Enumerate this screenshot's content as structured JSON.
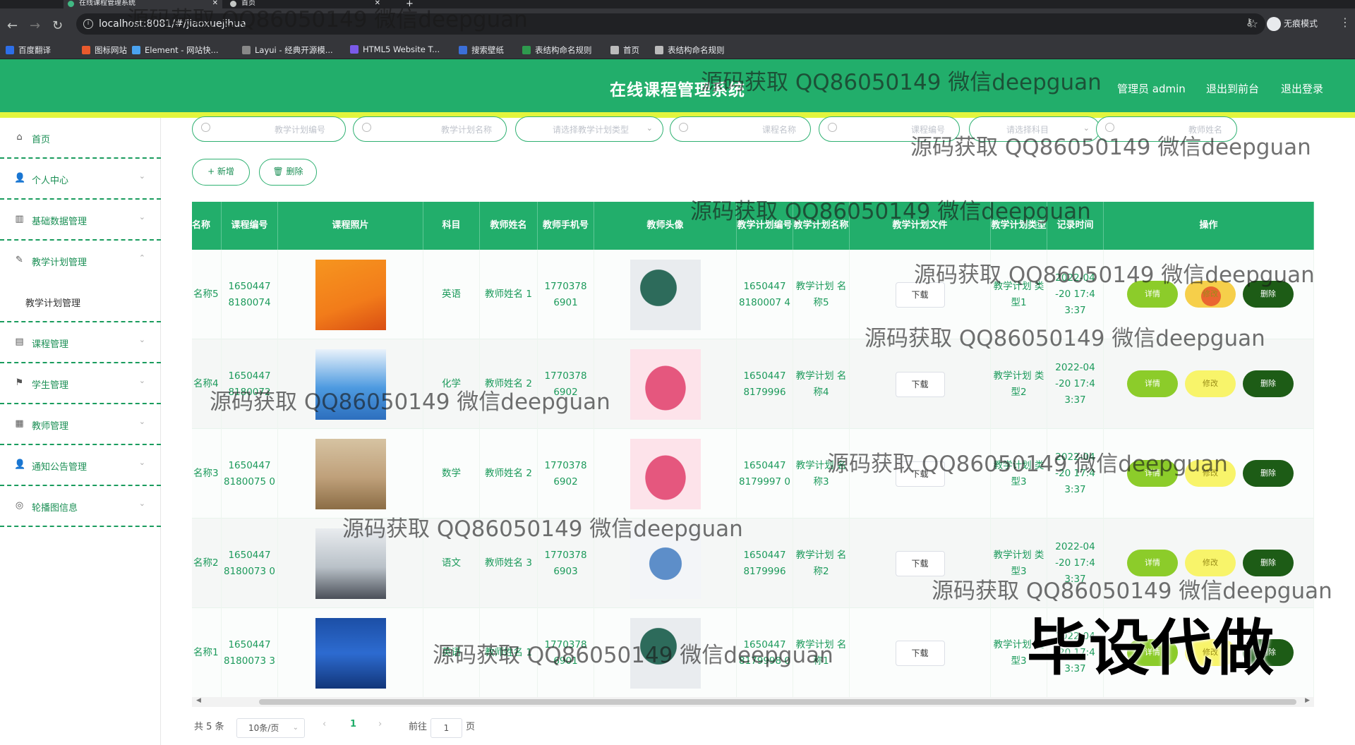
{
  "browser": {
    "tabs": [
      {
        "label": "在线课程管理系统"
      },
      {
        "label": "首页"
      }
    ],
    "url": "localhost:8081/#/jiaoxuejihua",
    "incognito_label": "无痕模式",
    "bookmarks": [
      {
        "label": "百度翻译",
        "color": "#2d6fe8"
      },
      {
        "label": "图标网站",
        "color": "#e85a2d"
      },
      {
        "label": "Element - 网站快...",
        "color": "#4aa3f0"
      },
      {
        "label": "Layui - 经典开源模...",
        "color": "#888888"
      },
      {
        "label": "HTML5 Website T...",
        "color": "#7a5ae8"
      },
      {
        "label": "搜索壁纸",
        "color": "#3b6fd8"
      },
      {
        "label": "表结构命名规则",
        "color": "#2e9a4e"
      },
      {
        "label": "首页",
        "color": "#bbbbbb"
      },
      {
        "label": "表结构命名规则",
        "color": "#bbbbbb"
      }
    ]
  },
  "header": {
    "title": "在线课程管理系统",
    "admin": "管理员 admin",
    "back_front": "退出到前台",
    "logout": "退出登录",
    "color": "#22ae6b",
    "accent": "#e3f53d"
  },
  "sidebar": {
    "items": [
      {
        "label": "首页",
        "icon": "home-icon",
        "glyph": "⌂"
      },
      {
        "label": "个人中心",
        "icon": "user-icon",
        "glyph": "👤"
      },
      {
        "label": "基础数据管理",
        "icon": "bar-chart-icon",
        "glyph": "▥"
      },
      {
        "label": "教学计划管理",
        "icon": "edit-icon",
        "glyph": "✎"
      },
      {
        "label": "课程管理",
        "icon": "briefcase-icon",
        "glyph": "▤"
      },
      {
        "label": "学生管理",
        "icon": "flag-icon",
        "glyph": "⚑"
      },
      {
        "label": "教师管理",
        "icon": "clipboard-icon",
        "glyph": "▦"
      },
      {
        "label": "通知公告管理",
        "icon": "user-icon",
        "glyph": "👤"
      },
      {
        "label": "轮播图信息",
        "icon": "compass-icon",
        "glyph": "◎"
      }
    ],
    "sub_item": "教学计划管理"
  },
  "filters": [
    {
      "placeholder": "教学计划编号",
      "type": "input"
    },
    {
      "placeholder": "教学计划名称",
      "type": "input"
    },
    {
      "placeholder": "请选择教学计划类型",
      "type": "select"
    },
    {
      "placeholder": "课程名称",
      "type": "input"
    },
    {
      "placeholder": "课程编号",
      "type": "input"
    },
    {
      "placeholder": "请选择科目",
      "type": "select"
    },
    {
      "placeholder": "教师姓名",
      "type": "input"
    }
  ],
  "actions": {
    "add": "+ 新增",
    "delete": "🗑 删除"
  },
  "table": {
    "headers": [
      "名称",
      "课程编号",
      "课程照片",
      "科目",
      "教师姓名",
      "教师手机号",
      "教师头像",
      "教学计划编号",
      "教学计划名称",
      "教学计划文件",
      "教学计划类型",
      "记录时间",
      "操作"
    ],
    "rows": [
      {
        "name": "名称5",
        "code": "1650447 8180074",
        "subject": "英语",
        "teacher": "教师姓名 1",
        "phone": "1770378 6901",
        "plan_code": "1650447 8180007 4",
        "plan_name": "教学计划 名称5",
        "plan_type": "教学计划 类型1",
        "time": "2022-04 -20 17:4 3:37",
        "photo": "course-photo-1",
        "avatar": "avatar-teacher-blackboard"
      },
      {
        "name": "名称4",
        "code": "1650447 8180072",
        "subject": "化学",
        "teacher": "教师姓名 2",
        "phone": "1770378 6902",
        "plan_code": "1650447 8179996",
        "plan_name": "教学计划 名称4",
        "plan_type": "教学计划 类型2",
        "time": "2022-04 -20 17:4 3:37",
        "photo": "course-photo-2",
        "avatar": "avatar-cartoon-girl"
      },
      {
        "name": "名称3",
        "code": "1650447 8180075 0",
        "subject": "数学",
        "teacher": "教师姓名 2",
        "phone": "1770378 6902",
        "plan_code": "1650447 8179997 0",
        "plan_name": "教学计划 名称3",
        "plan_type": "教学计划 类型3",
        "time": "2022-04 -20 17:4 3:37",
        "photo": "course-photo-3",
        "avatar": "avatar-cartoon-girl"
      },
      {
        "name": "名称2",
        "code": "1650447 8180073 0",
        "subject": "语文",
        "teacher": "教师姓名 3",
        "phone": "1770378 6903",
        "plan_code": "1650447 8179996",
        "plan_name": "教学计划 名称2",
        "plan_type": "教学计划 类型3",
        "time": "2022-04 -20 17:4 3:37",
        "photo": "course-photo-4",
        "avatar": "avatar-cartoon-boy"
      },
      {
        "name": "名称1",
        "code": "1650447 8180073 3",
        "subject": "英语",
        "teacher": "教师姓名 1",
        "phone": "1770378 6901",
        "plan_code": "1650447 8179998 0",
        "plan_name": "教学计划 名称1",
        "plan_type": "教学计划 类型3",
        "time": "2022-04 -20 17:4 3:37",
        "photo": "course-photo-5",
        "avatar": "avatar-teacher-blackboard"
      }
    ],
    "download_label": "下载",
    "op_detail": "详情",
    "op_edit": "修改",
    "op_delete": "删除"
  },
  "pagination": {
    "total": "共 5 条",
    "page_size": "10条/页",
    "current": "1",
    "goto_label": "前往",
    "goto_value": "1",
    "page_suffix": "页"
  },
  "watermarks": {
    "text": "源码获取 QQ86050149 微信deepguan",
    "big": "毕设代做"
  }
}
